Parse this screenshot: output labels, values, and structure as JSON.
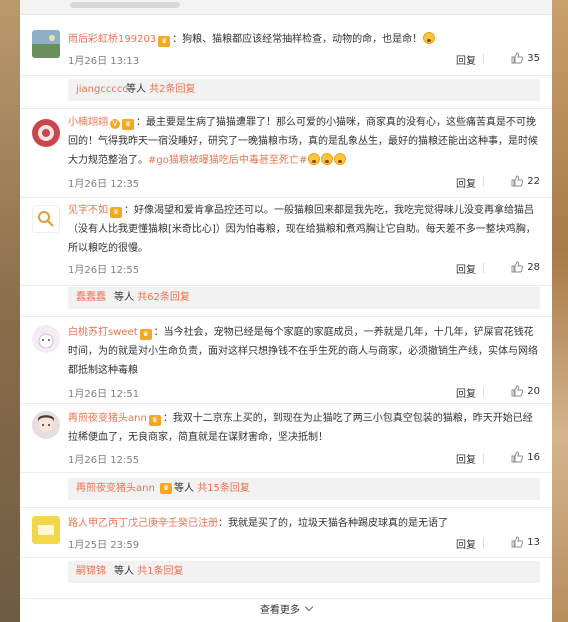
{
  "comments": [
    {
      "user": "雨后彩虹桥199203",
      "text": "：狗粮、猫粮都应该经常抽样检查，动物的命，也是命！",
      "topic": "",
      "date": "1月26日 13:13",
      "reply_label": "回复",
      "likes": "35",
      "avatar_color": "#6b8f5c"
    },
    {
      "user": "小楠翊翊",
      "text": "：最主要是生病了猫猫遭罪了！那么可爱的小猫咪，商家真的没有心，这些痛苦真是不可挽回的！气得我昨天一宿没睡好，研究了一晚猫粮市场，真的是乱象丛生，最好的猫粮还能出这种事，是时候大力规范整治了。",
      "topic": "#go猫粮被曝猫吃后中毒甚至死亡#",
      "date": "1月26日 12:35",
      "reply_label": "回复",
      "likes": "22",
      "avatar_color": "#c9474c"
    },
    {
      "user": "见字不如",
      "text": "：好像渴望和爱肯拿品控还可以。一般猫粮回来都是我先吃，我吃完觉得味儿没变再拿给猫吕（没有人比我更懂猫粮[米奇比心]）因为怕毒粮，现在给猫粮和煮鸡胸让它自助。每天差不多一整块鸡胸，所以粮吃的很慢。",
      "topic": "",
      "date": "1月26日 12:55",
      "reply_label": "回复",
      "likes": "28",
      "avatar_color": "#ffffff"
    },
    {
      "user": "白桃苏打sweet",
      "text": "：当今社会，宠物已经是每个家庭的家庭成员，一养就是几年，十几年，铲屎官花钱花时间，为的就是对小生命负责，面对这样只想挣钱不在乎生死的商人与商家，必须撤销生产线，实体与网络都抵制这种毒粮",
      "topic": "",
      "date": "1月26日 12:51",
      "reply_label": "回复",
      "likes": "20",
      "avatar_color": "#ead3ec"
    },
    {
      "user": "再煎夜变猪头ann",
      "text": "：我双十二京东上买的，到现在为止猫吃了两三小包真空包装的猫粮，昨天开始已经拉稀便血了，无良商家，简直就是在谋财害命，坚决抵制！",
      "topic": "",
      "date": "1月26日 12:55",
      "reply_label": "回复",
      "likes": "16",
      "avatar_color": "#e9dde0"
    },
    {
      "user": "路人甲乙丙丁戊己庚辛壬癸已注册",
      "text": "：我就是买了的，垃圾天猫各种踢皮球真的是无语了",
      "topic": "",
      "date": "1月25日 23:59",
      "reply_label": "回复",
      "likes": "13",
      "avatar_color": "#f2d64b"
    }
  ],
  "sub_replies": [
    {
      "user": "jiangccccc",
      "between": "等人",
      "count": "共2条回复"
    },
    {
      "user": "蠢蠢蠢",
      "between": "等人",
      "count": "共62条回复"
    },
    {
      "user": "再煎夜变猪头ann",
      "between": "等人",
      "count": "共15条回复"
    },
    {
      "user": "嗣锦锦",
      "between": "等人",
      "count": "共1条回复"
    }
  ],
  "footer": {
    "more_label": "查看更多"
  },
  "colors": {
    "accent": "#eb7350",
    "badge": "#f6a821"
  }
}
